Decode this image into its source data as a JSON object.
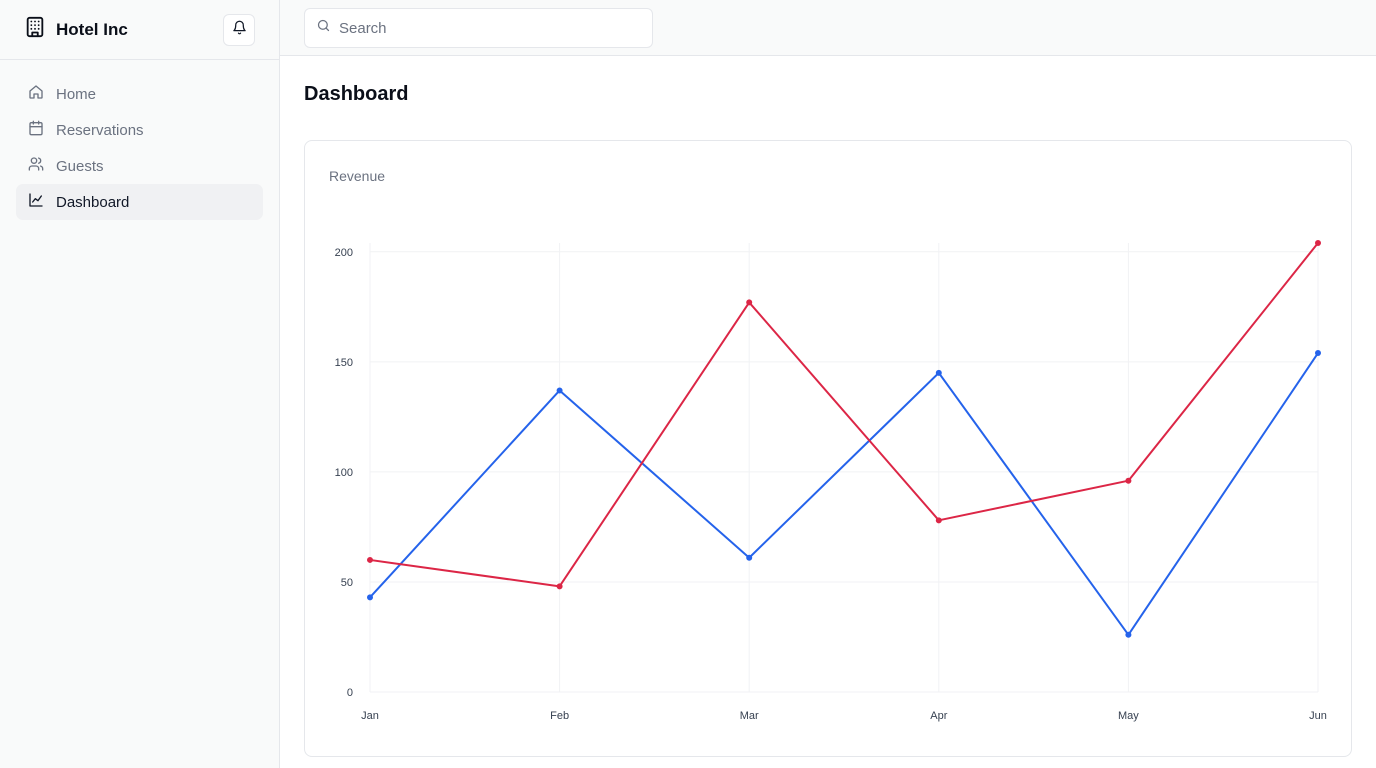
{
  "app": {
    "name": "Hotel Inc"
  },
  "sidebar": {
    "items": [
      {
        "label": "Home",
        "icon": "home-icon",
        "active": false
      },
      {
        "label": "Reservations",
        "icon": "calendar-icon",
        "active": false
      },
      {
        "label": "Guests",
        "icon": "users-icon",
        "active": false
      },
      {
        "label": "Dashboard",
        "icon": "line-chart-icon",
        "active": true
      }
    ]
  },
  "header": {
    "search_placeholder": "Search"
  },
  "main": {
    "title": "Dashboard"
  },
  "colors": {
    "series_blue": "#2563eb",
    "series_red": "#dc2646",
    "grid": "#f1f2f4"
  },
  "chart_data": {
    "type": "line",
    "title": "Revenue",
    "categories": [
      "Jan",
      "Feb",
      "Mar",
      "Apr",
      "May",
      "Jun"
    ],
    "y_ticks": [
      0,
      50,
      100,
      150,
      200
    ],
    "ylim": [
      0,
      204
    ],
    "grid": true,
    "legend": "none",
    "series": [
      {
        "color": "#2563eb",
        "values": [
          43,
          137,
          61,
          145,
          26,
          154
        ]
      },
      {
        "color": "#dc2646",
        "values": [
          60,
          48,
          177,
          78,
          96,
          204
        ]
      }
    ]
  }
}
